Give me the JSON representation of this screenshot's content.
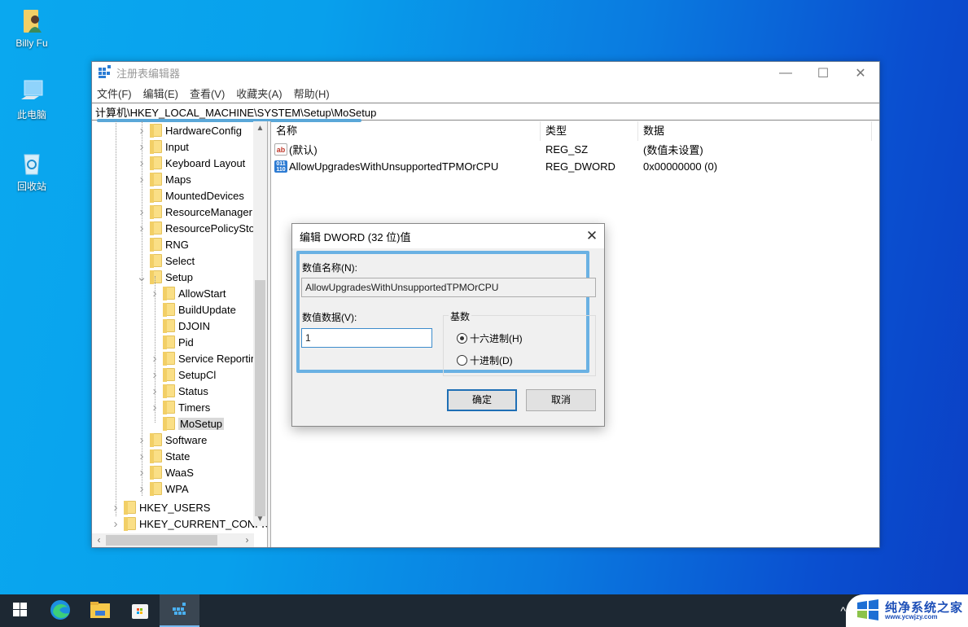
{
  "desktop": {
    "icons": [
      {
        "label": "Billy Fu",
        "icon": "user-folder-icon"
      },
      {
        "label": "此电脑",
        "icon": "computer-icon"
      },
      {
        "label": "回收站",
        "icon": "recycle-bin-icon"
      }
    ]
  },
  "window": {
    "title": "注册表编辑器",
    "controls": {
      "minimize": "—",
      "maximize": "☐",
      "close": "✕"
    },
    "menu": [
      "文件(F)",
      "编辑(E)",
      "查看(V)",
      "收藏夹(A)",
      "帮助(H)"
    ],
    "address": "计算机\\HKEY_LOCAL_MACHINE\\SYSTEM\\Setup\\MoSetup",
    "tree": [
      {
        "label": "HardwareConfig",
        "level": 2,
        "expander": ">"
      },
      {
        "label": "Input",
        "level": 2,
        "expander": ">"
      },
      {
        "label": "Keyboard Layout",
        "level": 2,
        "expander": ">"
      },
      {
        "label": "Maps",
        "level": 2,
        "expander": ">"
      },
      {
        "label": "MountedDevices",
        "level": 2,
        "expander": ""
      },
      {
        "label": "ResourceManager",
        "level": 2,
        "expander": ">"
      },
      {
        "label": "ResourcePolicySto",
        "level": 2,
        "expander": ">"
      },
      {
        "label": "RNG",
        "level": 2,
        "expander": ""
      },
      {
        "label": "Select",
        "level": 2,
        "expander": ""
      },
      {
        "label": "Setup",
        "level": 2,
        "expander": "v"
      },
      {
        "label": "AllowStart",
        "level": 3,
        "expander": ">"
      },
      {
        "label": "BuildUpdate",
        "level": 3,
        "expander": ""
      },
      {
        "label": "DJOIN",
        "level": 3,
        "expander": ""
      },
      {
        "label": "Pid",
        "level": 3,
        "expander": ""
      },
      {
        "label": "Service Reportin",
        "level": 3,
        "expander": ">"
      },
      {
        "label": "SetupCl",
        "level": 3,
        "expander": ">"
      },
      {
        "label": "Status",
        "level": 3,
        "expander": ">"
      },
      {
        "label": "Timers",
        "level": 3,
        "expander": ">"
      },
      {
        "label": "MoSetup",
        "level": 3,
        "expander": "",
        "selected": true
      },
      {
        "label": "Software",
        "level": 2,
        "expander": ">"
      },
      {
        "label": "State",
        "level": 2,
        "expander": ">"
      },
      {
        "label": "WaaS",
        "level": 2,
        "expander": ">"
      },
      {
        "label": "WPA",
        "level": 2,
        "expander": ">"
      },
      {
        "label": "HKEY_USERS",
        "level": 0,
        "expander": ">"
      },
      {
        "label": "HKEY_CURRENT_CONFIG",
        "level": 0,
        "expander": ">"
      }
    ],
    "list": {
      "columns": [
        "名称",
        "类型",
        "数据"
      ],
      "rows": [
        {
          "icon": "string-value-icon",
          "icon_text": "ab",
          "name": "(默认)",
          "type": "REG_SZ",
          "data": "(数值未设置)"
        },
        {
          "icon": "dword-value-icon",
          "icon_text": "011 110",
          "name": "AllowUpgradesWithUnsupportedTPMOrCPU",
          "type": "REG_DWORD",
          "data": "0x00000000 (0)"
        }
      ]
    }
  },
  "dialog": {
    "title": "编辑 DWORD (32 位)值",
    "close": "✕",
    "name_label": "数值名称(N):",
    "name_value": "AllowUpgradesWithUnsupportedTPMOrCPU",
    "data_label": "数值数据(V):",
    "data_value": "1",
    "base_label": "基数",
    "base_options": [
      {
        "label": "十六进制(H)",
        "selected": true
      },
      {
        "label": "十进制(D)",
        "selected": false
      }
    ],
    "ok": "确定",
    "cancel": "取消"
  },
  "taskbar": {
    "items": [
      "start-icon",
      "edge-icon",
      "file-explorer-icon",
      "store-icon",
      "regedit-icon"
    ],
    "active": "regedit-icon",
    "tray_chevron": "^",
    "watermark": {
      "title": "纯净系统之家",
      "url": "www.ycwjzy.com"
    }
  }
}
